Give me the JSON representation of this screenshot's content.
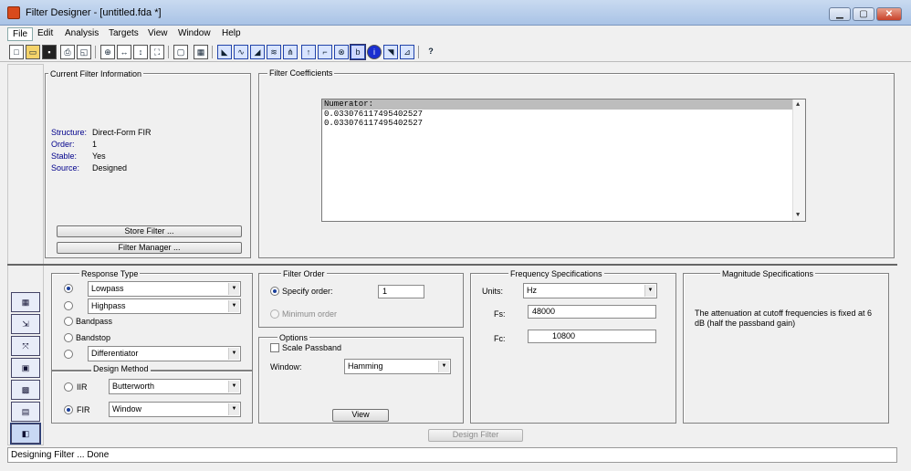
{
  "window": {
    "title": "Filter Designer - [untitled.fda *]",
    "min_glyph": "▁",
    "max_glyph": "▢",
    "close_glyph": "✕"
  },
  "menu": [
    "File",
    "Edit",
    "Analysis",
    "Targets",
    "View",
    "Window",
    "Help"
  ],
  "current_filter": {
    "legend": "Current Filter Information",
    "rows": [
      {
        "label": "Structure:",
        "value": "Direct-Form FIR"
      },
      {
        "label": "Order:",
        "value": "1"
      },
      {
        "label": "Stable:",
        "value": "Yes"
      },
      {
        "label": "Source:",
        "value": "Designed"
      }
    ],
    "store_button": "Store Filter ...",
    "manager_button": "Filter Manager ..."
  },
  "coefficients": {
    "legend": "Filter Coefficients",
    "header": "Numerator:",
    "values": [
      "0.033076117495402527",
      "0.033076117495402527"
    ]
  },
  "response_type": {
    "legend": "Response Type",
    "lowpass": "Lowpass",
    "highpass": "Highpass",
    "bandpass": "Bandpass",
    "bandstop": "Bandstop",
    "differentiator": "Differentiator"
  },
  "design_method": {
    "legend": "Design Method",
    "iir_label": "IIR",
    "iir_value": "Butterworth",
    "fir_label": "FIR",
    "fir_value": "Window"
  },
  "filter_order": {
    "legend": "Filter Order",
    "specify_label": "Specify order:",
    "specify_value": "1",
    "minimum_label": "Minimum order"
  },
  "options": {
    "legend": "Options",
    "scale_passband": "Scale Passband",
    "window_label": "Window:",
    "window_value": "Hamming",
    "view_button": "View"
  },
  "frequency_specs": {
    "legend": "Frequency Specifications",
    "units_label": "Units:",
    "units_value": "Hz",
    "fs_label": "Fs:",
    "fs_value": "48000",
    "fc_label": "Fc:",
    "fc_value": "10800"
  },
  "magnitude_specs": {
    "legend": "Magnitude Specifications",
    "note": "The attenuation at cutoff frequencies is fixed at 6 dB (half the passband gain)"
  },
  "design_button": "Design Filter",
  "status": "Designing Filter ... Done"
}
